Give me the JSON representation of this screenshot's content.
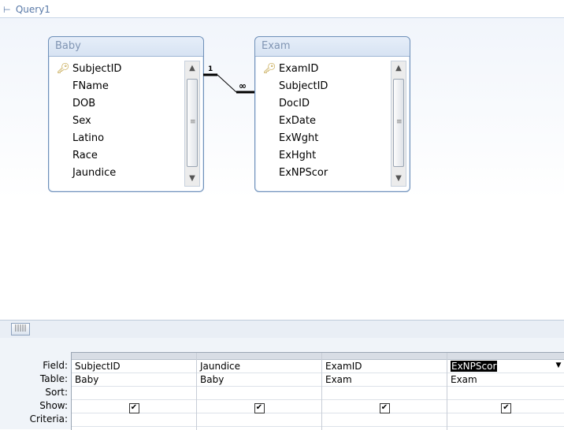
{
  "window": {
    "tab_title": "Query1"
  },
  "tables": [
    {
      "name": "Baby",
      "fields": [
        "SubjectID",
        "FName",
        "DOB",
        "Sex",
        "Latino",
        "Race",
        "Jaundice"
      ],
      "key_field": "SubjectID"
    },
    {
      "name": "Exam",
      "fields": [
        "ExamID",
        "SubjectID",
        "DocID",
        "ExDate",
        "ExWght",
        "ExHght",
        "ExNPScor"
      ],
      "key_field": "ExamID"
    }
  ],
  "relationship": {
    "one_label": "1",
    "many_label": "∞"
  },
  "grid": {
    "row_labels": [
      "Field:",
      "Table:",
      "Sort:",
      "Show:",
      "Criteria:"
    ],
    "columns": [
      {
        "field": "SubjectID",
        "table": "Baby",
        "sort": "",
        "show": true
      },
      {
        "field": "Jaundice",
        "table": "Baby",
        "sort": "",
        "show": true
      },
      {
        "field": "ExamID",
        "table": "Exam",
        "sort": "",
        "show": true
      },
      {
        "field": "ExNPScor",
        "table": "Exam",
        "sort": "",
        "show": true,
        "selected": true
      }
    ],
    "checkmark": "✔"
  },
  "colors": {
    "table_border": "#6d8fb8",
    "title_text": "#8095b3"
  }
}
